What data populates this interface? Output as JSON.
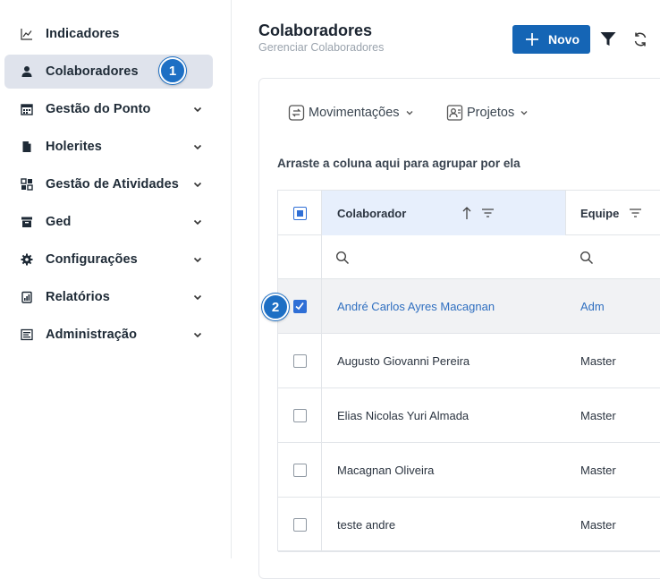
{
  "sidebar": {
    "items": [
      {
        "label": "Indicadores",
        "icon": "chart-line-icon",
        "chevron": false
      },
      {
        "label": "Colaboradores",
        "icon": "user-icon",
        "chevron": false,
        "active": true
      },
      {
        "label": "Gestão do Ponto",
        "icon": "calendar-icon",
        "chevron": true
      },
      {
        "label": "Holerites",
        "icon": "document-icon",
        "chevron": true
      },
      {
        "label": "Gestão de Atividades",
        "icon": "grid-icon",
        "chevron": true
      },
      {
        "label": "Ged",
        "icon": "archive-icon",
        "chevron": true
      },
      {
        "label": "Configurações",
        "icon": "gear-icon",
        "chevron": true
      },
      {
        "label": "Relatórios",
        "icon": "report-icon",
        "chevron": true
      },
      {
        "label": "Administração",
        "icon": "admin-icon",
        "chevron": true
      }
    ]
  },
  "annotations": {
    "step1": "1",
    "step2": "2"
  },
  "header": {
    "title": "Colaboradores",
    "subtitle": "Gerenciar Colaboradores",
    "new_button": "Novo"
  },
  "toolbar": {
    "movimentacoes": "Movimentações",
    "projetos": "Projetos"
  },
  "grid": {
    "group_hint": "Arraste a coluna aqui para agrupar por ela",
    "columns": [
      "Colaborador",
      "Equipe"
    ],
    "rows": [
      {
        "name": "André Carlos Ayres Macagnan",
        "team": "Adm",
        "selected": true
      },
      {
        "name": "Augusto Giovanni Pereira",
        "team": "Master",
        "selected": false
      },
      {
        "name": "Elias Nicolas Yuri Almada",
        "team": "Master",
        "selected": false
      },
      {
        "name": "Macagnan Oliveira",
        "team": "Master",
        "selected": false
      },
      {
        "name": "teste andre",
        "team": "Master",
        "selected": false
      }
    ]
  },
  "colors": {
    "accent": "#1565b5",
    "selected_text": "#2f6fc0",
    "active_nav": "#dfe3ec"
  }
}
